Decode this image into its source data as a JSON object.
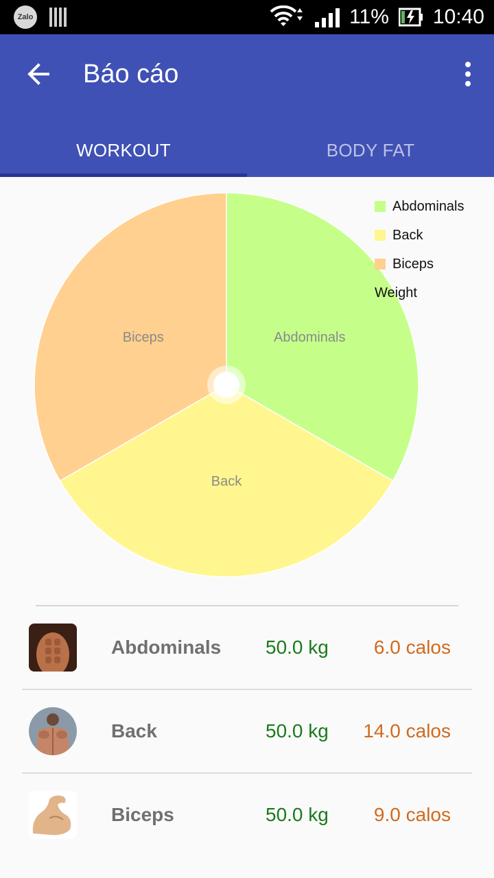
{
  "status_bar": {
    "notifications": [
      "zalo-icon",
      "sim-icon"
    ],
    "battery_percent": "11%",
    "time": "10:40"
  },
  "app_bar": {
    "title": "Báo cáo",
    "color": "#3f51b5"
  },
  "tabs": [
    {
      "label": "WORKOUT",
      "selected": true
    },
    {
      "label": "BODY FAT",
      "selected": false
    }
  ],
  "chart_data": {
    "type": "pie",
    "categories": [
      "Abdominals",
      "Back",
      "Biceps"
    ],
    "values": [
      33.33,
      33.33,
      33.33
    ],
    "colors": [
      "#c5ff8a",
      "#fff68f",
      "#ffd08f"
    ],
    "legend_title": "Weight",
    "legend_position": "top-right"
  },
  "list": [
    {
      "name": "Abdominals",
      "weight": "50.0 kg",
      "calos": "6.0 calos",
      "icon": "abdominals-photo-icon"
    },
    {
      "name": "Back",
      "weight": "50.0 kg",
      "calos": "14.0 calos",
      "icon": "back-photo-icon"
    },
    {
      "name": "Biceps",
      "weight": "50.0 kg",
      "calos": "9.0 calos",
      "icon": "biceps-arm-icon"
    }
  ]
}
